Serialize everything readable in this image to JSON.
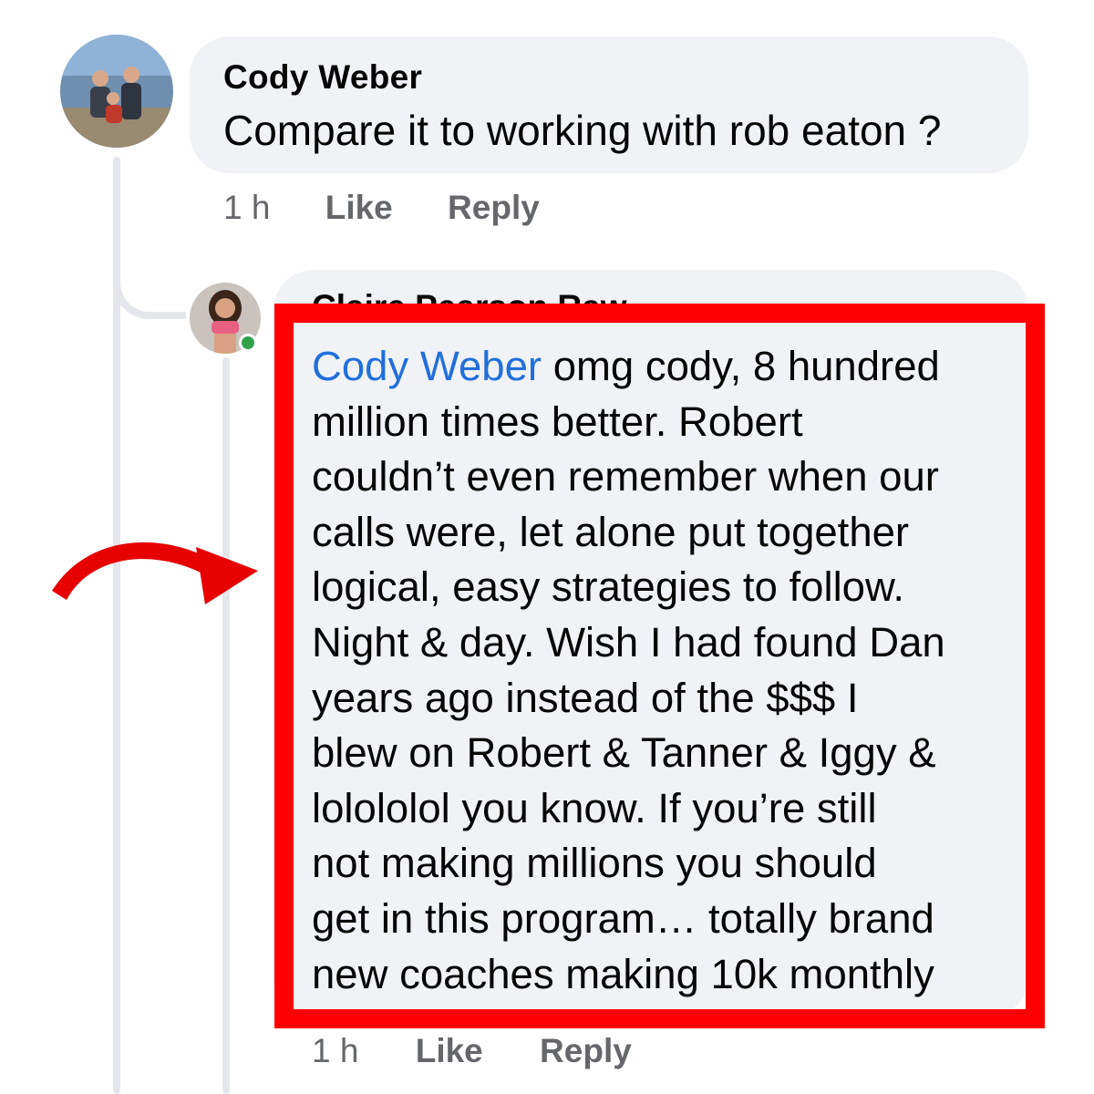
{
  "comments": [
    {
      "author": "Cody Weber",
      "text": "Compare it to working with rob eaton ?",
      "time": "1 h",
      "like_label": "Like",
      "reply_label": "Reply"
    },
    {
      "author": "Claire Pearson Raw",
      "mention": "Cody Weber",
      "text_lines": [
        " omg cody, 8 hundred",
        "million times better. Robert",
        "couldn’t even remember when our",
        "calls were, let alone put together",
        "logical, easy strategies to follow.",
        "Night & day. Wish I had found Dan",
        "years ago instead of the $$$ I",
        "blew on Robert & Tanner & Iggy &",
        "lolololol you know. If you’re still",
        "not making millions you should",
        "get in this program… totally brand",
        "new coaches making 10k monthly"
      ],
      "time": "1 h",
      "like_label": "Like",
      "reply_label": "Reply",
      "online": true
    }
  ],
  "colors": {
    "highlight": "#ff0000",
    "arrow": "#e60000",
    "mention": "#216fdb",
    "bubble": "#f0f2f5",
    "online": "#31a24c"
  },
  "icons": {
    "annotation_arrow": "curved-arrow-icon"
  }
}
